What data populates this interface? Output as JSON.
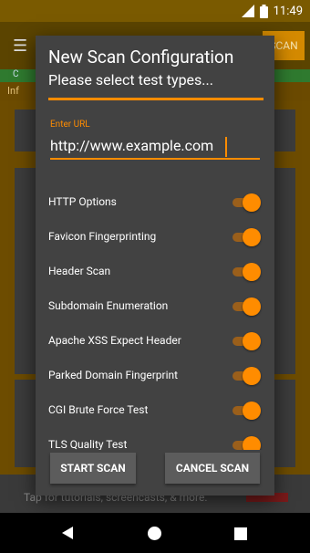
{
  "status_bar": {
    "time": "11:49",
    "icons": [
      "signal-icon",
      "battery-icon"
    ]
  },
  "background": {
    "menu_icon": "☰",
    "scan_button": "SCAN",
    "green_bar_text": "C",
    "info_text": "Inf",
    "footer_text": "Tap for tutorials, screencasts, & more."
  },
  "dialog": {
    "title": "New Scan Configuration",
    "subtitle": "Please select test types...",
    "url_label": "Enter URL",
    "url_value": "http://www.example.com",
    "options": [
      {
        "label": "HTTP Options",
        "enabled": true
      },
      {
        "label": "Favicon Fingerprinting",
        "enabled": true
      },
      {
        "label": "Header Scan",
        "enabled": true
      },
      {
        "label": "Subdomain Enumeration",
        "enabled": true
      },
      {
        "label": "Apache XSS Expect Header",
        "enabled": true
      },
      {
        "label": "Parked Domain Fingerprint",
        "enabled": true
      },
      {
        "label": "CGI Brute Force Test",
        "enabled": true
      },
      {
        "label": "TLS Quality Test",
        "enabled": true
      }
    ],
    "start_button": "START SCAN",
    "cancel_button": "CANCEL SCAN"
  },
  "nav": {
    "back": "back-icon",
    "home": "home-icon",
    "recents": "recents-icon"
  },
  "colors": {
    "accent": "#ff8c00",
    "dialog_bg": "#424242",
    "button_bg": "#5c5c5c"
  }
}
